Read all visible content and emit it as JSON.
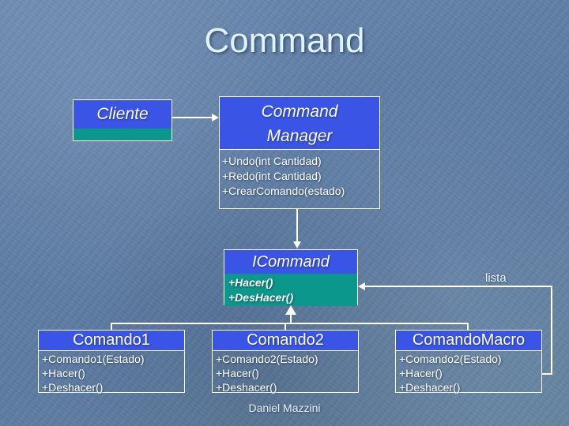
{
  "slide": {
    "title": "Command",
    "footer": "Daniel Mazzini",
    "background_color": "#6281a8",
    "accent_header_color": "#3a55e6",
    "accent_body_color": "#0b978b",
    "text_color": "#ffffff",
    "title_color": "#dff3fa"
  },
  "classes": {
    "cliente": {
      "name": "Cliente",
      "members": []
    },
    "command_manager": {
      "name_line1": "Command",
      "name_line2": "Manager",
      "members": [
        "+Undo(int Cantidad)",
        "+Redo(int Cantidad)",
        "+CrearComando(estado)"
      ]
    },
    "icommand": {
      "name": "ICommand",
      "members": [
        "+Hacer()",
        "+DesHacer()"
      ]
    },
    "comando1": {
      "name": "Comando1",
      "members": [
        "+Comando1(Estado)",
        "+Hacer()",
        "+Deshacer()"
      ]
    },
    "comando2": {
      "name": "Comando2",
      "members": [
        "+Comando2(Estado)",
        "+Hacer()",
        "+Deshacer()"
      ]
    },
    "comando_macro": {
      "name": "ComandoMacro",
      "members": [
        "+Comando2(Estado)",
        "+Hacer()",
        "+Deshacer()"
      ]
    }
  },
  "relations": {
    "lista_label": "lista"
  }
}
